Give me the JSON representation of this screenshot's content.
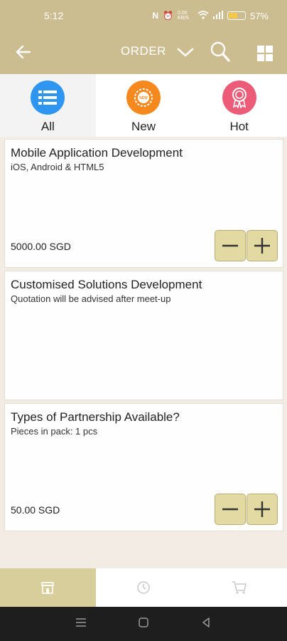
{
  "status_bar": {
    "time": "5:12",
    "network": "0.00 KB/S",
    "battery_percent": "57%",
    "battery_level": 0.57
  },
  "app_bar": {
    "title": "ORDER",
    "background": "#cbbd8f"
  },
  "tabs": [
    {
      "label": "All",
      "icon": "list-icon",
      "color": "#2e96f0"
    },
    {
      "label": "New",
      "icon": "new-badge-icon",
      "color": "#f5891e",
      "badge_text": "NEW"
    },
    {
      "label": "Hot",
      "icon": "award-ribbon-icon",
      "color": "#ec5b78"
    }
  ],
  "products": [
    {
      "title": "Mobile Application Development",
      "subtitle": "iOS, Android & HTML5",
      "price": "5000.00 SGD"
    },
    {
      "title": "Customised Solutions Development",
      "subtitle": "Quotation will be advised after meet-up",
      "price": ""
    },
    {
      "title": "Types of Partnership Available?",
      "subtitle": "Pieces in pack: 1 pcs",
      "price": "50.00 SGD"
    }
  ],
  "bottom_nav": [
    {
      "icon": "store-icon",
      "active": true
    },
    {
      "icon": "history-clock-icon",
      "active": false
    },
    {
      "icon": "cart-icon",
      "active": false
    }
  ],
  "colors": {
    "accent": "#cbbd8f",
    "button": "#e3d9a3"
  }
}
